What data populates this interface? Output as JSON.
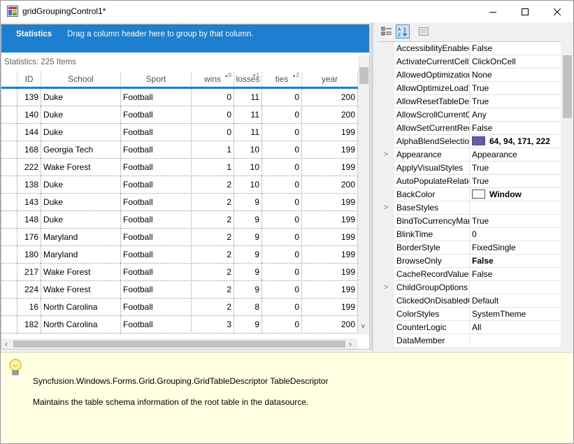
{
  "window": {
    "title": "gridGroupingControl1*"
  },
  "group_drop": {
    "tag": "Statistics",
    "hint": "Drag a column header here to group by that column."
  },
  "stats": {
    "label": "Statistics: 225 Items"
  },
  "grid": {
    "columns": [
      {
        "label": "ID"
      },
      {
        "label": "School"
      },
      {
        "label": "Sport"
      },
      {
        "label": "wins",
        "sort_dir": "up",
        "sort_index": "0"
      },
      {
        "label": "losses",
        "sort_dir": "down",
        "sort_index": "1"
      },
      {
        "label": "ties",
        "sort_dir": "up",
        "sort_index": "2"
      },
      {
        "label": "year"
      }
    ],
    "rows": [
      [
        "139",
        "Duke",
        "Football",
        "0",
        "11",
        "0",
        "200"
      ],
      [
        "140",
        "Duke",
        "Football",
        "0",
        "11",
        "0",
        "200"
      ],
      [
        "144",
        "Duke",
        "Football",
        "0",
        "11",
        "0",
        "199"
      ],
      [
        "168",
        "Georgia Tech",
        "Football",
        "1",
        "10",
        "0",
        "199"
      ],
      [
        "222",
        "Wake Forest",
        "Football",
        "1",
        "10",
        "0",
        "199"
      ],
      [
        "138",
        "Duke",
        "Football",
        "2",
        "10",
        "0",
        "200"
      ],
      [
        "143",
        "Duke",
        "Football",
        "2",
        "9",
        "0",
        "199"
      ],
      [
        "148",
        "Duke",
        "Football",
        "2",
        "9",
        "0",
        "199"
      ],
      [
        "176",
        "Maryland",
        "Football",
        "2",
        "9",
        "0",
        "199"
      ],
      [
        "180",
        "Maryland",
        "Football",
        "2",
        "9",
        "0",
        "199"
      ],
      [
        "217",
        "Wake Forest",
        "Football",
        "2",
        "9",
        "0",
        "199"
      ],
      [
        "224",
        "Wake Forest",
        "Football",
        "2",
        "9",
        "0",
        "199"
      ],
      [
        "16",
        "North Carolina",
        "Football",
        "2",
        "8",
        "0",
        "199"
      ],
      [
        "182",
        "North Carolina",
        "Football",
        "3",
        "9",
        "0",
        "200"
      ]
    ]
  },
  "property_grid": {
    "toolbar": [
      "categorized-icon",
      "alphabetical-icon",
      "property-pages-icon"
    ],
    "alphablend_color": "#5e5eab",
    "backcolor_color": "#ffffff",
    "properties": [
      {
        "name": "AccessibilityEnabled",
        "value": "False",
        "expand": "",
        "bold": false
      },
      {
        "name": "ActivateCurrentCellBehavior",
        "value": "ClickOnCell",
        "expand": "",
        "bold": false
      },
      {
        "name": "AllowedOptimizations",
        "value": "None",
        "expand": "",
        "bold": false
      },
      {
        "name": "AllowOptimizeLoadTime",
        "value": "True",
        "expand": "",
        "bold": false
      },
      {
        "name": "AllowResetTableDescriptor",
        "value": "True",
        "expand": "",
        "bold": false
      },
      {
        "name": "AllowScrollCurrentCellInView",
        "value": "Any",
        "expand": "",
        "bold": false
      },
      {
        "name": "AllowSetCurrentRecord",
        "value": "False",
        "expand": "",
        "bold": false
      },
      {
        "name": "AlphaBlendSelectionColor",
        "value": "64, 94, 171, 222",
        "expand": "",
        "bold": true,
        "swatch": "alphablend"
      },
      {
        "name": "Appearance",
        "value": "Appearance",
        "expand": ">",
        "bold": false
      },
      {
        "name": "ApplyVisualStyles",
        "value": "True",
        "expand": "",
        "bold": false
      },
      {
        "name": "AutoPopulateRelations",
        "value": "True",
        "expand": "",
        "bold": false
      },
      {
        "name": "BackColor",
        "value": "Window",
        "expand": "",
        "bold": true,
        "swatch": "backcolor"
      },
      {
        "name": "BaseStyles",
        "value": "",
        "expand": ">",
        "bold": false
      },
      {
        "name": "BindToCurrencyManager",
        "value": "True",
        "expand": "",
        "bold": false
      },
      {
        "name": "BlinkTime",
        "value": "0",
        "expand": "",
        "bold": false
      },
      {
        "name": "BorderStyle",
        "value": "FixedSingle",
        "expand": "",
        "bold": false
      },
      {
        "name": "BrowseOnly",
        "value": "False",
        "expand": "",
        "bold": true
      },
      {
        "name": "CacheRecordValues",
        "value": "False",
        "expand": "",
        "bold": false
      },
      {
        "name": "ChildGroupOptions",
        "value": "",
        "expand": ">",
        "bold": false
      },
      {
        "name": "ClickedOnDisabledCell",
        "value": "Default",
        "expand": "",
        "bold": false
      },
      {
        "name": "ColorStyles",
        "value": "SystemTheme",
        "expand": "",
        "bold": false
      },
      {
        "name": "CounterLogic",
        "value": "All",
        "expand": "",
        "bold": false
      },
      {
        "name": "DataMember",
        "value": "",
        "expand": "",
        "bold": false
      }
    ]
  },
  "description": {
    "type": "Syncfusion.Windows.Forms.Grid.Grouping.GridTableDescriptor TableDescriptor",
    "text": "Maintains the table schema information of the root table in the datasource."
  },
  "colors": {
    "accent": "#1e7fd0",
    "desc_bg": "#ffffe1"
  }
}
